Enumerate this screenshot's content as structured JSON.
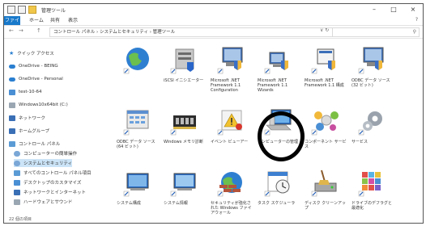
{
  "window": {
    "title": "管理ツール",
    "controls": [
      "–",
      "□",
      "×"
    ]
  },
  "ribbon": {
    "tabs": [
      "ファイル",
      "ホーム",
      "共有",
      "表示"
    ],
    "help": "?"
  },
  "address": {
    "back": "←",
    "forward": "→",
    "up": "↑",
    "path": "コントロール パネル › システムとセキュリティ › 管理ツール",
    "dropdown": "∨ ↻",
    "search_icon": "⚲"
  },
  "nav": {
    "items": [
      {
        "label": "クイック アクセス",
        "icon": "star-icon"
      },
      {
        "label": "OneDrive - BEING",
        "icon": "cloud-icon"
      },
      {
        "label": "OneDrive - Personal",
        "icon": "cloud-icon"
      },
      {
        "label": "test-10-64",
        "icon": "pc-icon"
      },
      {
        "label": "Windows10x64bit (C:)",
        "icon": "drive-icon"
      },
      {
        "label": "ネットワーク",
        "icon": "network-icon"
      },
      {
        "label": "ホームグループ",
        "icon": "homegroup-icon"
      },
      {
        "label": "コントロール パネル",
        "icon": "control-panel-icon"
      },
      {
        "label": "コンピューターの簡単操作",
        "icon": "accessibility-icon"
      },
      {
        "label": "システムとセキュリティ",
        "icon": "shield-icon"
      },
      {
        "label": "すべてのコントロール パネル項目",
        "icon": "control-panel-icon"
      },
      {
        "label": "デスクトップのカスタマイズ",
        "icon": "desktop-icon"
      },
      {
        "label": "ネットワークとインターネット",
        "icon": "network-icon"
      },
      {
        "label": "ハードウェアとサウンド",
        "icon": "hardware-icon"
      }
    ],
    "status": "22 個の項目"
  },
  "items": [
    {
      "label": "",
      "icon": "globe-icon"
    },
    {
      "label": "iSCSI イニシエーター",
      "icon": "iscsi-icon"
    },
    {
      "label": "Microsoft .NET Framework 1.1 Configuration",
      "icon": "dotnet-icon"
    },
    {
      "label": "Microsoft .NET Framework 1.1 Wizards",
      "icon": "dotnet-icon"
    },
    {
      "label": "Microsoft .NET Framework 1.1 構成",
      "icon": "dotnet-icon"
    },
    {
      "label": "ODBC データ ソース (32 ビット)",
      "icon": "odbc-icon"
    },
    {
      "label": "ODBC データ ソース (64 ビット)",
      "icon": "odbc-icon"
    },
    {
      "label": "Windows メモリ診断",
      "icon": "memory-icon"
    },
    {
      "label": "イベント ビューアー",
      "icon": "event-viewer-icon"
    },
    {
      "label": "コンピューターの管理",
      "icon": "computer-management-icon"
    },
    {
      "label": "コンポーネント サービス",
      "icon": "component-services-icon"
    },
    {
      "label": "サービス",
      "icon": "services-gear-icon"
    },
    {
      "label": "システム構成",
      "icon": "system-config-icon"
    },
    {
      "label": "システム情報",
      "icon": "system-info-icon"
    },
    {
      "label": "セキュリティが強化された Windows ファイアウォール",
      "icon": "firewall-icon"
    },
    {
      "label": "タスク スケジューラ",
      "icon": "task-scheduler-icon"
    },
    {
      "label": "ディスク クリーンアップ",
      "icon": "disk-cleanup-icon"
    },
    {
      "label": "ドライブのデフラグと最適化",
      "icon": "defrag-icon"
    }
  ]
}
